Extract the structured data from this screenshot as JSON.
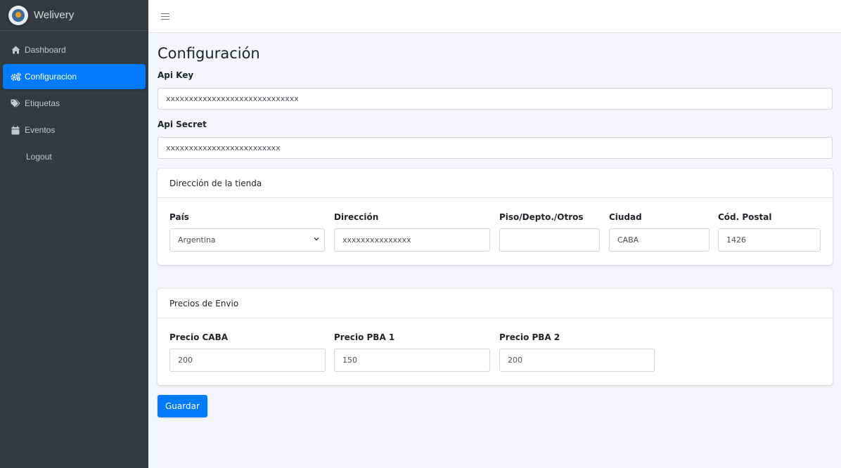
{
  "brand": {
    "name": "Welivery"
  },
  "sidebar": {
    "items": [
      {
        "label": "Dashboard",
        "icon": "home-icon"
      },
      {
        "label": "Configuracion",
        "icon": "cogs-icon",
        "active": true
      },
      {
        "label": "Etiquetas",
        "icon": "tags-icon"
      },
      {
        "label": "Eventos",
        "icon": "calendar-icon"
      },
      {
        "label": "Logout"
      }
    ]
  },
  "page": {
    "title": "Configuración"
  },
  "api": {
    "key_label": "Api Key",
    "key_value": "xxxxxxxxxxxxxxxxxxxxxxxxxxxxx",
    "secret_label": "Api Secret",
    "secret_value": "xxxxxxxxxxxxxxxxxxxxxxxxx"
  },
  "address": {
    "header": "Dirección de la tienda",
    "pais_label": "País",
    "pais_value": "Argentina",
    "direccion_label": "Dirección",
    "direccion_value": "xxxxxxxxxxxxxxx",
    "piso_label": "Piso/Depto./Otros",
    "piso_value": "",
    "ciudad_label": "Ciudad",
    "ciudad_value": "CABA",
    "postal_label": "Cód. Postal",
    "postal_value": "1426"
  },
  "prices": {
    "header": "Precios de Envio",
    "caba_label": "Precio CABA",
    "caba_value": "200",
    "pba1_label": "Precio PBA 1",
    "pba1_value": "150",
    "pba2_label": "Precio PBA 2",
    "pba2_value": "200"
  },
  "actions": {
    "save_label": "Guardar"
  },
  "colors": {
    "sidebar": "#343a40",
    "accent": "#007bff",
    "background": "#f4f6f9"
  }
}
